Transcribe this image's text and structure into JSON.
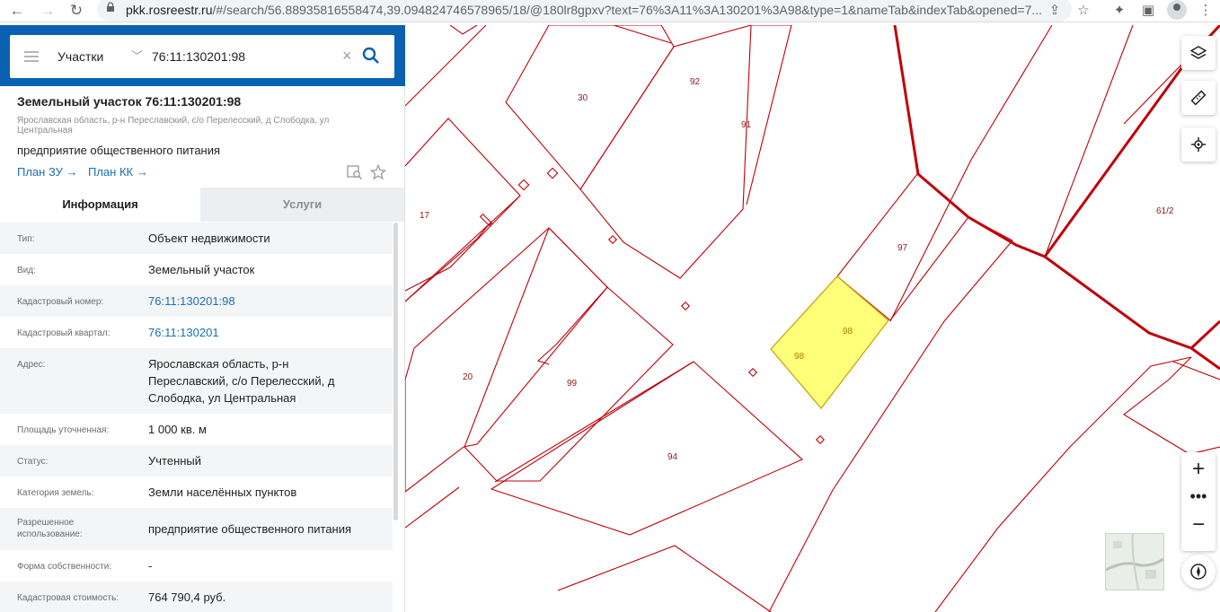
{
  "browser": {
    "url_host": "pkk.rosreestr.ru",
    "url_path": "/#/search/56.88935816558474,39.094824746578965/18/@180lr8gpxv?text=76%3A11%3A130201%3A98&type=1&nameTab&indexTab&opened=7..."
  },
  "search": {
    "type_label": "Участки",
    "query": "76:11:130201:98"
  },
  "object": {
    "title": "Земельный участок 76:11:130201:98",
    "address_small": "Ярославская область, р-н Переславский, с/о Перелесский, д Слободка, ул Центральная",
    "use": "предприятие общественного питания",
    "plan_zu": "План ЗУ →",
    "plan_kk": "План КК →"
  },
  "tabs": {
    "info": "Информация",
    "services": "Услуги"
  },
  "info_rows": [
    {
      "label": "Тип:",
      "value": "Объект недвижимости"
    },
    {
      "label": "Вид:",
      "value": "Земельный участок"
    },
    {
      "label": "Кадастровый номер:",
      "value": "76:11:130201:98"
    },
    {
      "label": "Кадастровый квартал:",
      "value": "76:11:130201"
    },
    {
      "label": "Адрес:",
      "value": "Ярославская область, р-н Переславский, с/о Перелесский, д Слободка, ул Центральная"
    },
    {
      "label": "Площадь уточненная:",
      "value": "1 000 кв. м"
    },
    {
      "label": "Статус:",
      "value": "Учтенный"
    },
    {
      "label": "Категория земель:",
      "value": "Земли населённых пунктов"
    },
    {
      "label": "Разрешенное использование:",
      "value": "предприятие общественного питания"
    },
    {
      "label": "Форма собственности:",
      "value": "-"
    },
    {
      "label": "Кадастровая стоимость:",
      "value": "764 790,4 руб."
    }
  ],
  "map": {
    "parcel_labels": [
      "30",
      "92",
      "91",
      "17",
      "61/2",
      "97",
      "98",
      "98",
      "20",
      "99",
      "94"
    ],
    "colors": {
      "boundary": "#c0000a",
      "selected_fill": "#ffff7a",
      "selected_stroke": "#c8a000",
      "accent": "#0a61b2"
    }
  }
}
